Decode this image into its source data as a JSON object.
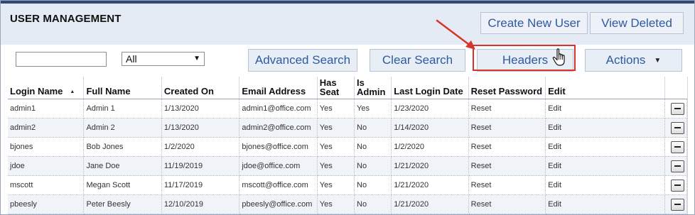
{
  "header": {
    "title": "USER MANAGEMENT",
    "create_label": "Create New User",
    "deleted_label": "View Deleted"
  },
  "toolbar": {
    "search_value": "",
    "filter_selected": "All",
    "advanced_label": "Advanced Search",
    "clear_label": "Clear Search",
    "headers_label": "Headers",
    "actions_label": "Actions"
  },
  "table": {
    "columns": [
      "Login Name",
      "Full Name",
      "Created On",
      "Email Address",
      "Has Seat",
      "Is Admin",
      "Last Login Date",
      "Reset Password",
      "Edit"
    ],
    "rows": [
      [
        "admin1",
        "Admin 1",
        "1/13/2020",
        "admin1@office.com",
        "Yes",
        "Yes",
        "1/23/2020",
        "Reset",
        "Edit"
      ],
      [
        "admin2",
        "Admin 2",
        "1/13/2020",
        "admin2@office.com",
        "Yes",
        "No",
        "1/14/2020",
        "Reset",
        "Edit"
      ],
      [
        "bjones",
        "Bob Jones",
        "1/2/2020",
        "bjones@office.com",
        "Yes",
        "No",
        "1/2/2020",
        "Reset",
        "Edit"
      ],
      [
        "jdoe",
        "Jane Doe",
        "11/19/2019",
        "jdoe@office.com",
        "Yes",
        "No",
        "1/21/2020",
        "Reset",
        "Edit"
      ],
      [
        "mscott",
        "Megan Scott",
        "11/17/2019",
        "mscott@office.com",
        "Yes",
        "No",
        "1/21/2020",
        "Reset",
        "Edit"
      ],
      [
        "pbeesly",
        "Peter Beesly",
        "12/10/2019",
        "pbeesly@office.com",
        "Yes",
        "No",
        "1/21/2020",
        "Reset",
        "Edit"
      ]
    ]
  },
  "colors": {
    "accent": "#2e5aa1",
    "highlight": "#d9342b",
    "header_bg": "#e4ebf4"
  },
  "icons": {
    "cursor": "hand-pointer-icon",
    "arrow": "annotation-arrow-icon",
    "remove": "minus-icon"
  }
}
